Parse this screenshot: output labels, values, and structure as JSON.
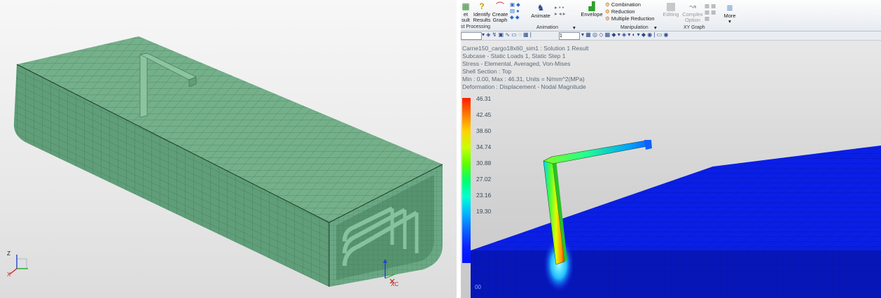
{
  "left_view": {
    "triad_top": {
      "z": "Z",
      "x": "X"
    },
    "triad_wcs": {
      "x": "XC"
    }
  },
  "ribbon": {
    "result_btn": {
      "line1": "et",
      "line2": "sult"
    },
    "identify_btn": {
      "line1": "Identify",
      "line2": "Results"
    },
    "create_graph_btn": {
      "line1": "Create",
      "line2": "Graph"
    },
    "post_processing_group": "st Processing",
    "animate_btn": "Animate",
    "animation_group": "Animation",
    "envelope_btn": "Envelope",
    "combination": "Combination",
    "reduction": "Reduction",
    "multiple_reduction": "Multiple Reduction",
    "manipulation_group": "Manipulation",
    "editing_btn": "Editing",
    "complex_option": {
      "line1": "Complex",
      "line2": "Option"
    },
    "xy_graph_group": "XY Graph",
    "more_btn": "More"
  },
  "toolbar": {
    "count_value": "1"
  },
  "result_info": [
    "Carne150_cargo18x60_sim1 : Solution 1 Result",
    "Subcase - Static Loads 1, Static Step 1",
    "Stress - Elemental, Averaged, Von-Mises",
    "Shell Section : Top",
    "Min : 0.00, Max : 46.31, Units = N/mm^2(MPa)",
    "Deformation : Displacement - Nodal Magnitude"
  ],
  "legend": {
    "values": [
      "46.31",
      "42.45",
      "38.60",
      "34.74",
      "30.88",
      "27.02",
      "23.16",
      "19.30"
    ],
    "colors": [
      "#ff1a00",
      "#ff7a00",
      "#ffd200",
      "#c8ff00",
      "#5cff00",
      "#00ff6a",
      "#00ffd4",
      "#00b4ff",
      "#0a64ff",
      "#0a24ff",
      "#0010ff"
    ]
  },
  "viewport_label": "00",
  "colors": {
    "mesh_green": "#5f9e78",
    "fea_blue": "#0a1fe6"
  }
}
